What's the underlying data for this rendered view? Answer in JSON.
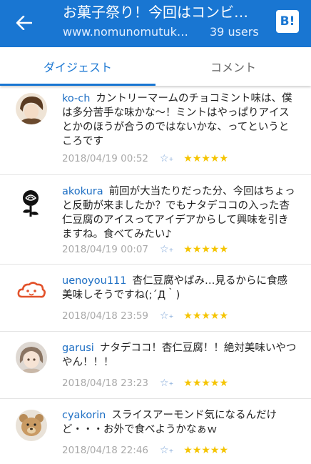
{
  "header": {
    "title": "お菓子祭り！今回はコンビ…",
    "url": "www.nomunomutuk…",
    "users": "39 users",
    "service_logo": "B!",
    "accent_color": "#1976d2"
  },
  "tabs": [
    {
      "label": "ダイジェスト",
      "active": true
    },
    {
      "label": "コメント",
      "active": false
    }
  ],
  "comments": [
    {
      "user": "ko-ch",
      "text": "カントリーマームのチョコミント味は、僕は多分苦手な味かな〜！ミントはやっぱりアイスとかのほうが合うのではないかな、ってというところです",
      "timestamp": "2018/04/19 00:52",
      "stars": "★★★★★"
    },
    {
      "user": "akokura",
      "text": "前回が大当たりだった分、今回はちょっと反動が来ましたか？でもナタデココの入った杏仁豆腐のアイスってアイデアからして興味を引きますね。食べてみたい♪",
      "timestamp": "2018/04/19 00:07",
      "stars": "★★★★★"
    },
    {
      "user": "uenoyou111",
      "text": "杏仁豆腐やばみ…見るからに食感美味しそうですね(;´Д｀)",
      "timestamp": "2018/04/18 23:59",
      "stars": "★★★★★"
    },
    {
      "user": "garusi",
      "text": "ナタデココ！杏仁豆腐！！絶対美味いやつやん！！！",
      "timestamp": "2018/04/18 23:23",
      "stars": "★★★★★"
    },
    {
      "user": "cyakorin",
      "text": "スライスアーモンド気になるんだけど・・・お外で食べようかなぁｗ",
      "timestamp": "2018/04/18 22:46",
      "stars": "★★★★★"
    }
  ],
  "add_star_icon": "☆",
  "add_star_plus": "+"
}
